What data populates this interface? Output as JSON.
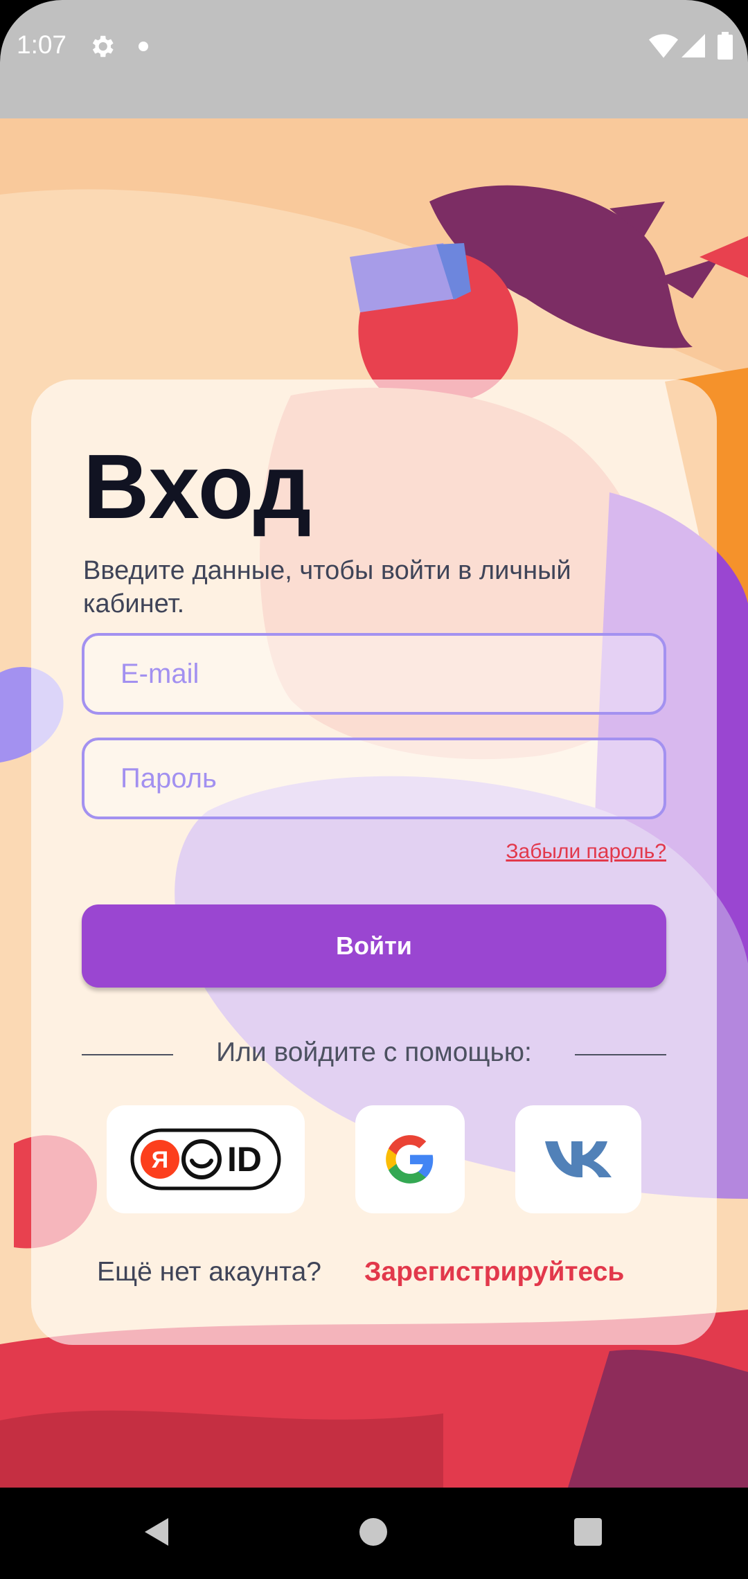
{
  "status_bar": {
    "time": "1:07",
    "icons": [
      "gear-icon",
      "notification-dot-icon",
      "wifi-icon",
      "signal-icon",
      "battery-icon"
    ]
  },
  "login": {
    "title": "Вход",
    "subtitle": "Введите данные, чтобы войти в личный кабинет.",
    "email_placeholder": "E-mail",
    "password_placeholder": "Пароль",
    "forgot_password": "Забыли пароль?",
    "login_button": "Войти",
    "alt_login_text": "Или войдите с помощью:",
    "social_providers": [
      "Яндекс ID",
      "Google",
      "VK"
    ],
    "no_account_text": "Ещё нет акаунта?",
    "register_link": "Зарегистрируйтесь"
  },
  "colors": {
    "accent": "#9a46d1",
    "field_border": "#a391f0",
    "link": "#e2384b",
    "status_bar": "#c0c0c0"
  },
  "nav_bar": {
    "icons": [
      "back-icon",
      "home-icon",
      "recents-icon"
    ]
  }
}
